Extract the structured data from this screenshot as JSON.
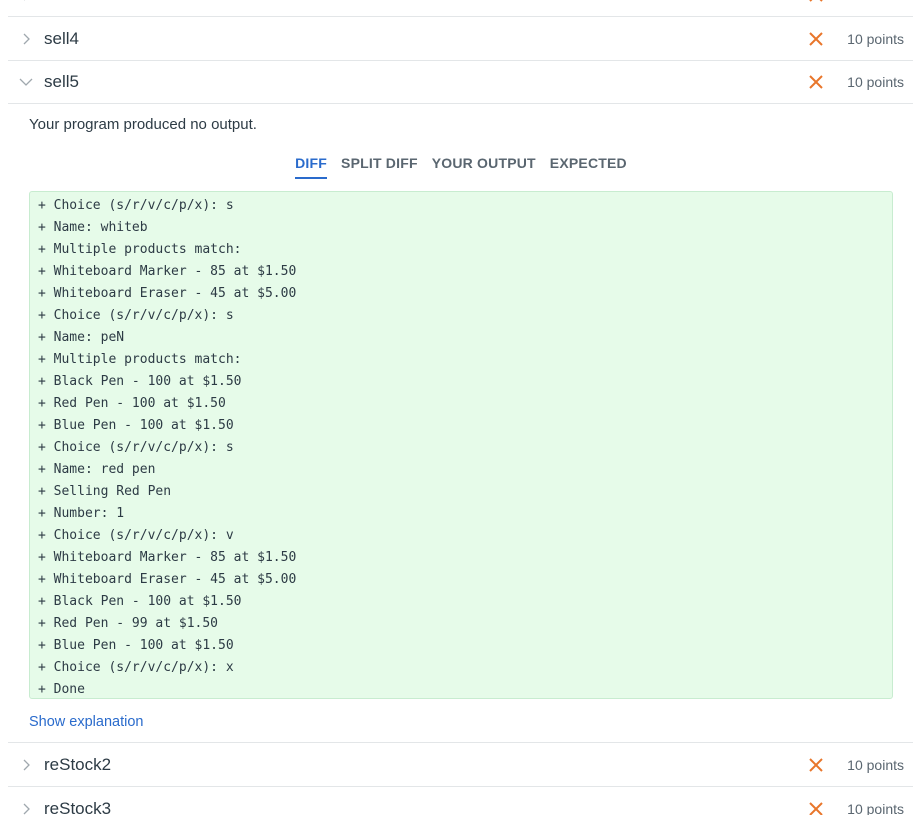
{
  "tests_above": [
    {
      "name": "sell4",
      "points": "10 points"
    }
  ],
  "expanded_test": {
    "name": "sell5",
    "points": "10 points",
    "message": "Your program produced no output.",
    "tabs": [
      "DIFF",
      "SPLIT DIFF",
      "YOUR OUTPUT",
      "EXPECTED"
    ],
    "active_tab": "DIFF",
    "diff_lines": [
      "+ Choice (s/r/v/c/p/x): s",
      "+ Name: whiteb",
      "+ Multiple products match:",
      "+ Whiteboard Marker - 85 at $1.50",
      "+ Whiteboard Eraser - 45 at $5.00",
      "+ Choice (s/r/v/c/p/x): s",
      "+ Name: peN",
      "+ Multiple products match:",
      "+ Black Pen - 100 at $1.50",
      "+ Red Pen - 100 at $1.50",
      "+ Blue Pen - 100 at $1.50",
      "+ Choice (s/r/v/c/p/x): s",
      "+ Name: red pen",
      "+ Selling Red Pen",
      "+ Number: 1",
      "+ Choice (s/r/v/c/p/x): v",
      "+ Whiteboard Marker - 85 at $1.50",
      "+ Whiteboard Eraser - 45 at $5.00",
      "+ Black Pen - 100 at $1.50",
      "+ Red Pen - 99 at $1.50",
      "+ Blue Pen - 100 at $1.50",
      "+ Choice (s/r/v/c/p/x): x",
      "+ Done"
    ],
    "show_explanation": "Show explanation"
  },
  "tests_below": [
    {
      "name": "reStock2",
      "points": "10 points"
    },
    {
      "name": "reStock3",
      "points": "10 points"
    }
  ],
  "colors": {
    "fail_x": "#e8762b",
    "link": "#2a6bcc",
    "diff_bg": "#e6fbe9"
  },
  "icons": {
    "collapsed": "chevron-right-icon",
    "expanded": "chevron-down-icon",
    "fail": "close-icon"
  }
}
